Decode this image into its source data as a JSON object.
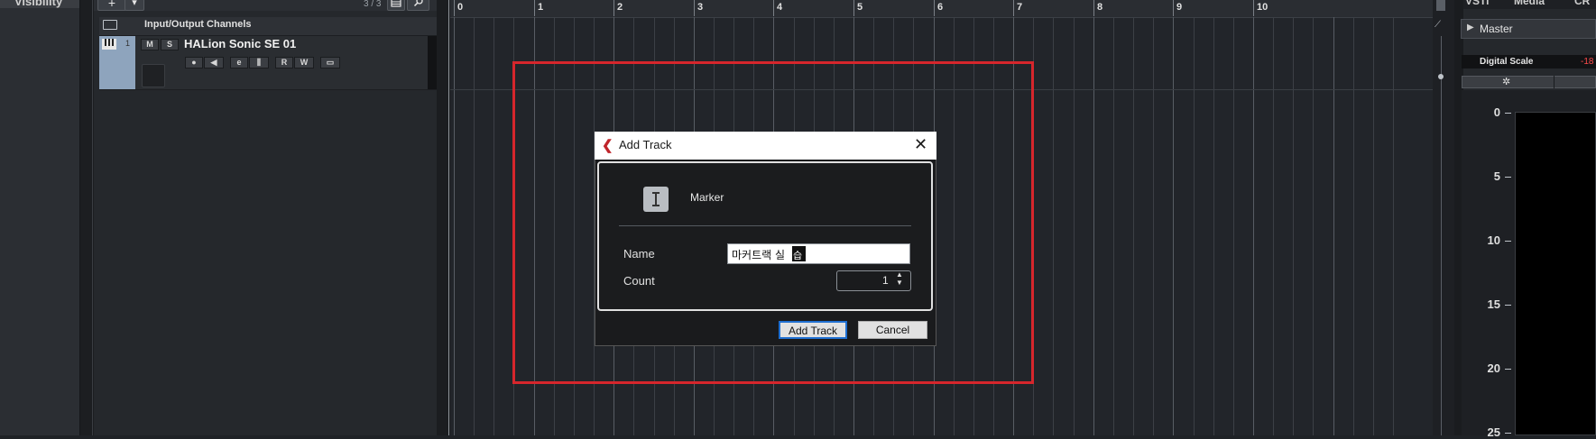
{
  "visibility_panel": {
    "title": "Visibility",
    "minimize": "–"
  },
  "track_list": {
    "add_label": "+",
    "dropdown_label": "▾",
    "track_count": "3 / 3",
    "tracks": [
      {
        "name": "Input/Output Channels"
      },
      {
        "number": "1",
        "name": "HALion Sonic SE 01",
        "mute": "M",
        "solo": "S",
        "read": "R",
        "write": "W"
      }
    ]
  },
  "ruler": {
    "bars": [
      "0",
      "1",
      "2",
      "3",
      "4",
      "5",
      "6",
      "7",
      "8",
      "9",
      "10"
    ]
  },
  "inspector": {
    "tabs": [
      "VSTi",
      "Media",
      "CR"
    ],
    "channel": "Master",
    "scale_label": "Digital Scale",
    "scale_value": "-18",
    "meter_labels": [
      "0",
      "5",
      "10",
      "15",
      "20",
      "25"
    ]
  },
  "dialog": {
    "title": "Add Track",
    "track_type": "Marker",
    "name_label": "Name",
    "name_value": "마커트랙 실",
    "name_composing_char": "습",
    "count_label": "Count",
    "count_value": "1",
    "add_button": "Add Track",
    "cancel_button": "Cancel"
  },
  "colors": {
    "highlight_rect": "#d6262c",
    "track_color": "#8ea4bd",
    "accent_logo": "#c0252b"
  }
}
